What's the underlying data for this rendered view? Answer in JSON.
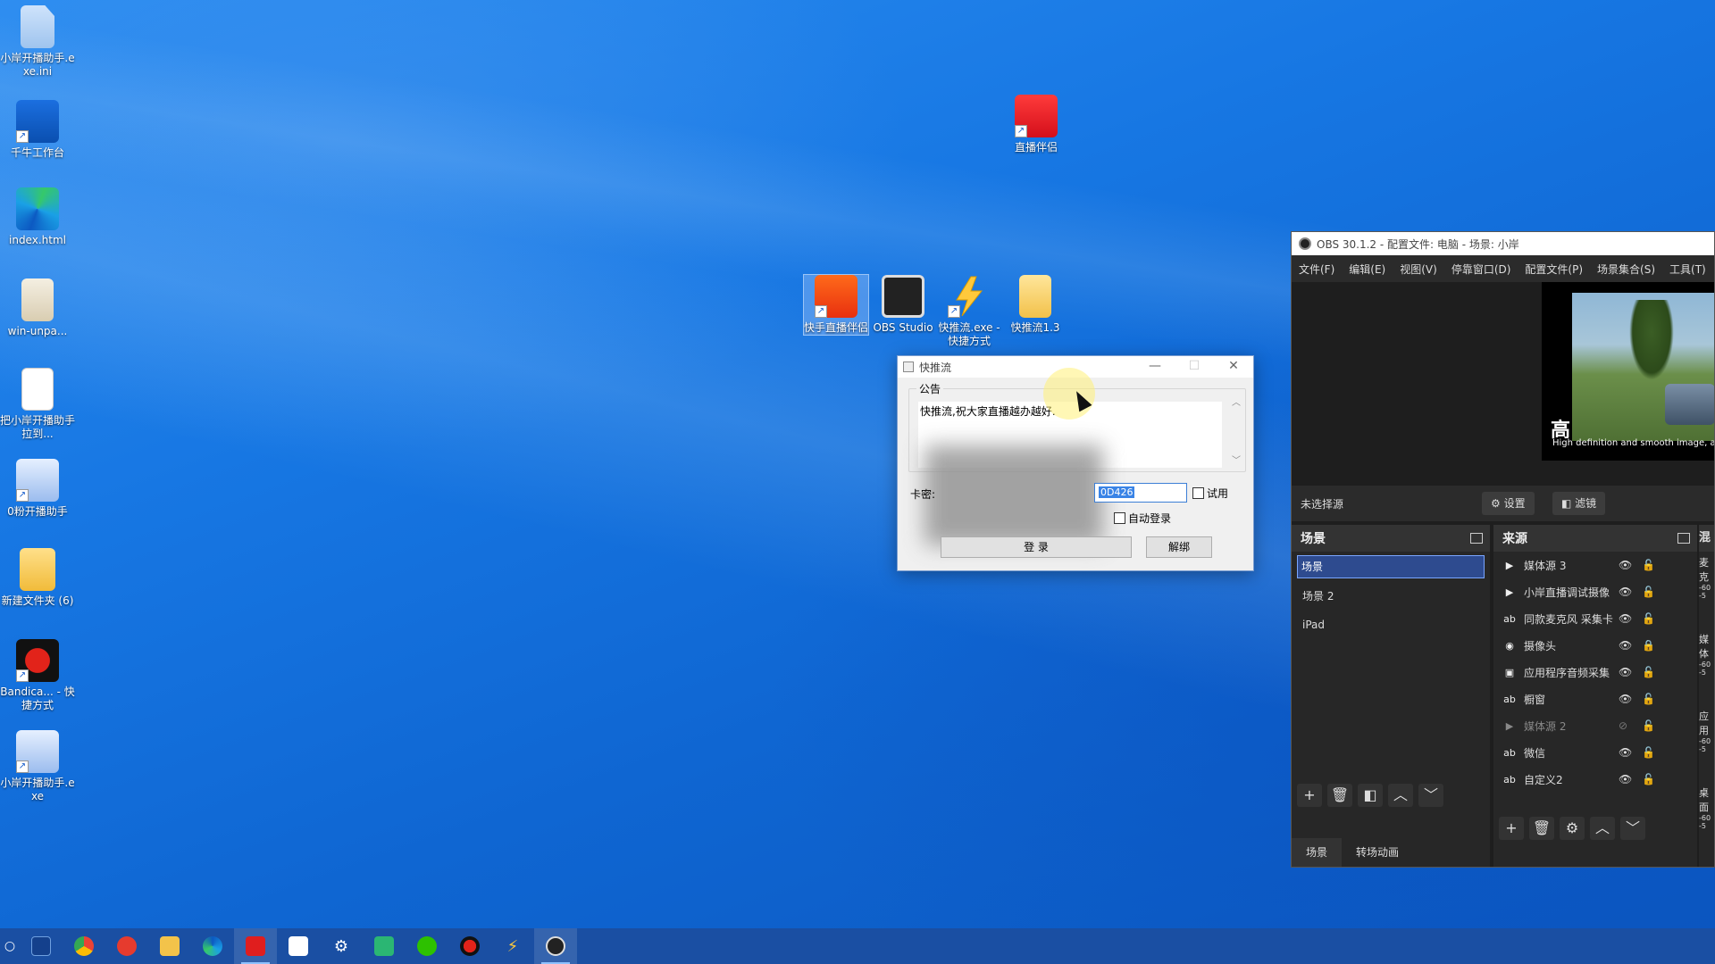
{
  "desktop": {
    "icons": [
      {
        "label": "小岸开播助手.exe.ini"
      },
      {
        "label": "千牛工作台"
      },
      {
        "label": "index.html"
      },
      {
        "label": "win-unpa..."
      },
      {
        "label": "把小岸开播助手拉到..."
      },
      {
        "label": "0粉开播助手"
      },
      {
        "label": "新建文件夹 (6)"
      },
      {
        "label": "Bandica... - 快捷方式"
      },
      {
        "label": "小岸开播助手.exe"
      },
      {
        "label": "直播伴侣"
      },
      {
        "label": "快手直播伴侣"
      },
      {
        "label": "OBS Studio"
      },
      {
        "label": "快推流.exe - 快捷方式"
      },
      {
        "label": "快推流1.3"
      }
    ]
  },
  "dialog": {
    "title": "快推流",
    "minimize": "—",
    "maximize": "☐",
    "close": "✕",
    "group_label": "公告",
    "notice": "快推流,祝大家直播越办越好.",
    "card_label": "卡密:",
    "card_value": "0D426",
    "trial_label": "试用",
    "autologin_label": "自动登录",
    "login_button": "登 录",
    "unbind_button": "解绑"
  },
  "obs": {
    "title": "OBS 30.1.2 - 配置文件: 电脑 - 场景: 小岸",
    "menu": [
      "文件(F)",
      "编辑(E)",
      "视图(V)",
      "停靠窗口(D)",
      "配置文件(P)",
      "场景集合(S)",
      "工具(T)"
    ],
    "preview_big_char": "高",
    "preview_subtext": "High definition and smooth image, au",
    "no_source": "未选择源",
    "settings_button": "⚙ 设置",
    "filters_button": "◧ 滤镜",
    "scenes_header": "场景",
    "scenes": [
      "场景",
      "场景 2",
      "iPad"
    ],
    "sources_header": "来源",
    "sources": [
      {
        "icon": "▶",
        "name": "媒体源 3"
      },
      {
        "icon": "▶",
        "name": "小岸直播调试摄像"
      },
      {
        "icon": "ab",
        "name": "同款麦克风 采集卡"
      },
      {
        "icon": "◉",
        "name": "摄像头"
      },
      {
        "icon": "▣",
        "name": "应用程序音频采集"
      },
      {
        "icon": "ab",
        "name": "橱窗"
      },
      {
        "icon": "▶",
        "name": "媒体源 2"
      },
      {
        "icon": "ab",
        "name": "微信"
      },
      {
        "icon": "ab",
        "name": "自定义2"
      }
    ],
    "tab_scenes": "场景",
    "tab_transitions": "转场动画",
    "mixer_header": "混",
    "mixer_labels": [
      "麦克",
      "媒体",
      "应用",
      "桌面"
    ],
    "mixer_scale": "-60 -5"
  },
  "colors": {
    "desktop_blue": "#1777e3",
    "taskbar": "#1a4fa3",
    "obs_bg": "#1e1e1e",
    "obs_selection": "#2e4b8f"
  }
}
